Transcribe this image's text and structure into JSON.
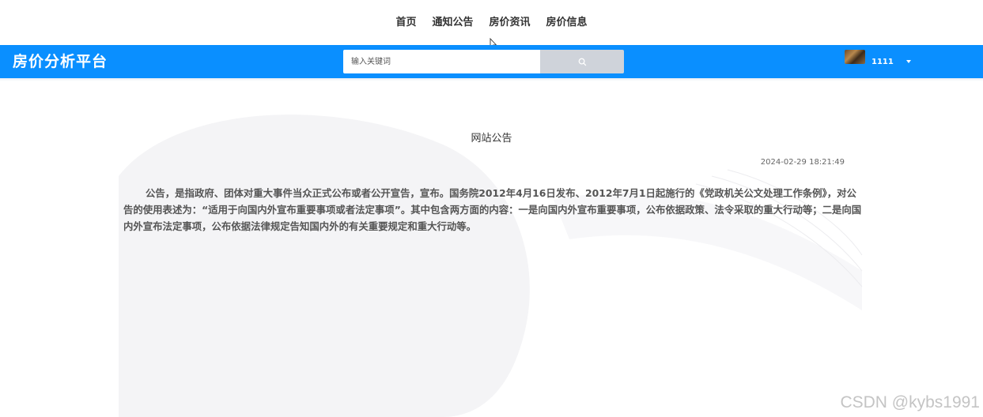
{
  "top_nav": {
    "items": [
      {
        "label": "首页"
      },
      {
        "label": "通知公告"
      },
      {
        "label": "房价资讯"
      },
      {
        "label": "房价信息"
      }
    ]
  },
  "header": {
    "brand": "房价分析平台",
    "search": {
      "placeholder": "输入关键词",
      "icon": "search-icon"
    },
    "user": {
      "name": "1111",
      "avatar": "avatar-image",
      "dropdown_icon": "caret-down-icon"
    },
    "color": "#0a8fff"
  },
  "notice": {
    "title": "网站公告",
    "time": "2024-02-29 18:21:49",
    "body": "公告，是指政府、团体对重大事件当众正式公布或者公开宣告，宣布。国务院2012年4月16日发布、2012年7月1日起施行的《党政机关公文处理工作条例》，对公告的使用表述为：“适用于向国内外宣布重要事项或者法定事项”。其中包含两方面的内容：一是向国内外宣布重要事项，公布依据政策、法令采取的重大行动等；二是向国内外宣布法定事项，公布依据法律规定告知国内外的有关重要规定和重大行动等。"
  },
  "watermark": "CSDN @kybs1991"
}
